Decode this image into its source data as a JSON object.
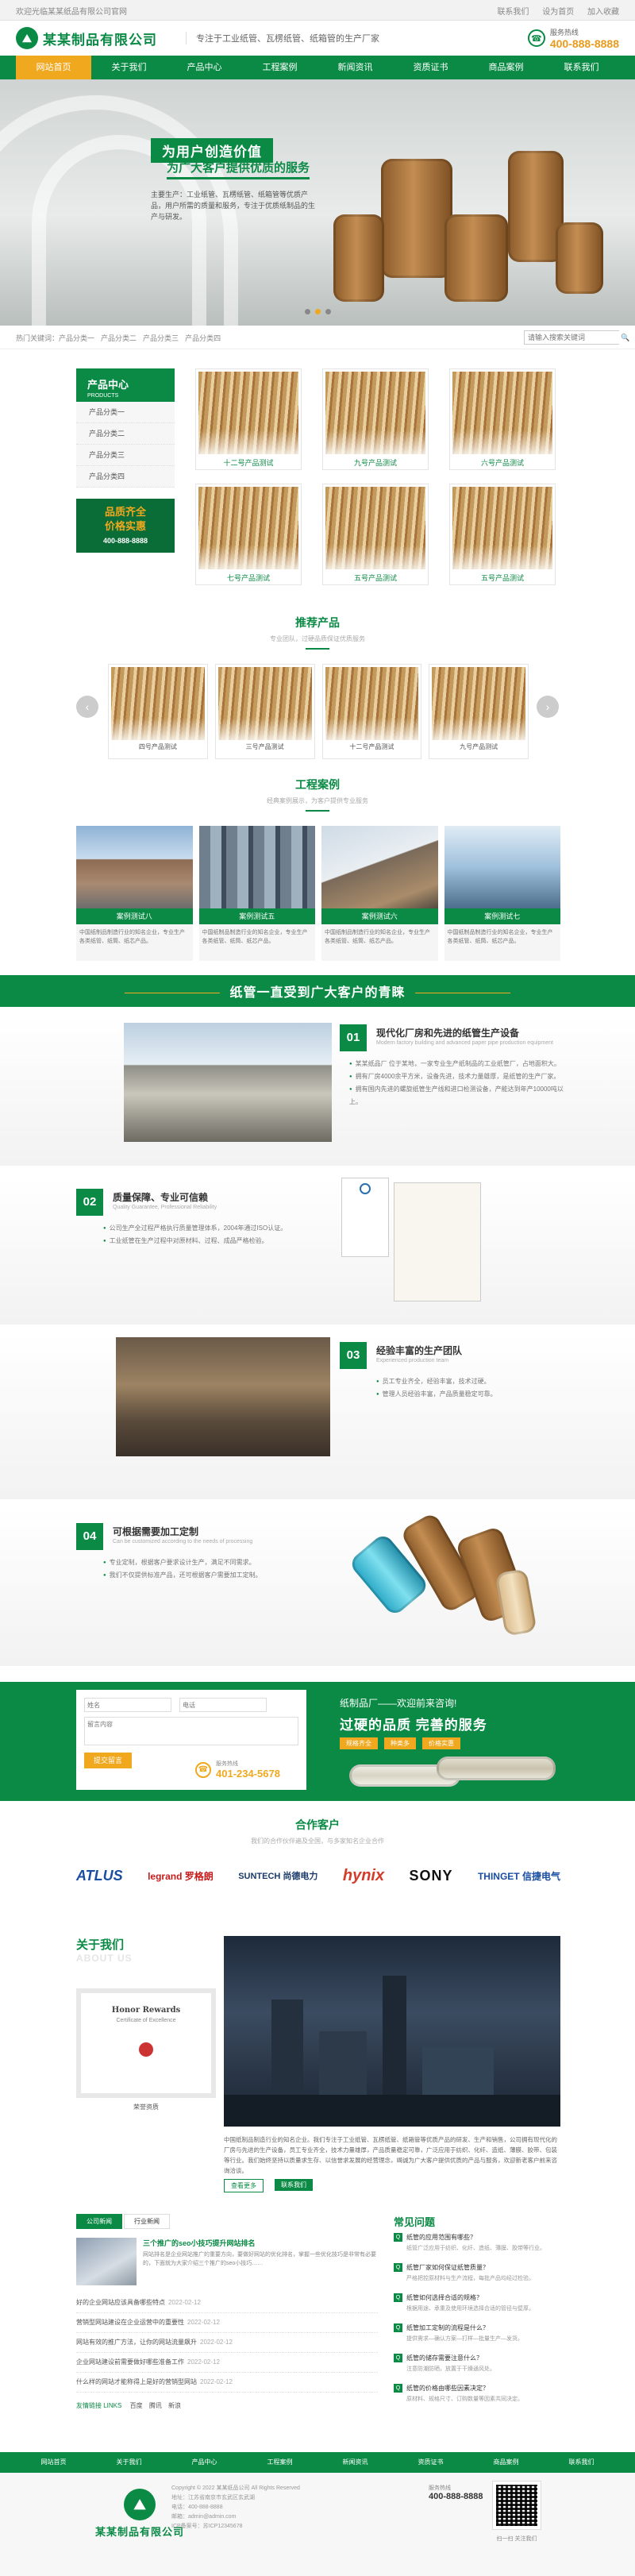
{
  "topbar": {
    "welcome": "欢迎光临某某纸品有限公司官网",
    "links": [
      "联系我们",
      "设为首页",
      "加入收藏"
    ]
  },
  "header": {
    "logo_text": "某某制品有限公司",
    "slogan": "专注于工业纸管、瓦楞纸管、纸箱管的生产厂家",
    "hotline_label": "服务热线",
    "hotline": "400-888-8888"
  },
  "nav": [
    "网站首页",
    "关于我们",
    "产品中心",
    "工程案例",
    "新闻资讯",
    "资质证书",
    "商品案例",
    "联系我们"
  ],
  "banner": {
    "title": "为用户创造价值",
    "subtitle": "为广大客户提供优质的服务",
    "text": "主要生产：工业纸管、瓦楞纸管、纸箱管等优质产品，用户所需的质量和服务，专注于优质纸制品的生产与研发。",
    "active_dot": 1
  },
  "crumb": {
    "hot_label": "热门关键词：",
    "keywords": [
      "产品分类一",
      "产品分类二",
      "产品分类三",
      "产品分类四"
    ],
    "search_placeholder": "请输入搜索关键词",
    "search_btn": "搜"
  },
  "prod_center": {
    "title": "产品中心",
    "en": "PRODUCTS",
    "cats": [
      "产品分类一",
      "产品分类二",
      "产品分类三",
      "产品分类四"
    ],
    "promo_line1": "品质齐全",
    "promo_line2": "价格实惠",
    "promo_phone": "400-888-8888",
    "items": [
      "十二号产品测试",
      "九号产品测试",
      "六号产品测试",
      "七号产品测试",
      "五号产品测试",
      "五号产品测试"
    ]
  },
  "recommend": {
    "title": "推荐产品",
    "sub": "专业团队，过硬品质保证优质服务",
    "items": [
      "四号产品测试",
      "三号产品测试",
      "十二号产品测试",
      "九号产品测试"
    ]
  },
  "cases": {
    "title": "工程案例",
    "sub": "经典案例展示，为客户提供专业服务",
    "items": [
      {
        "name": "案例测试八",
        "desc": "中国纸制品制造行业的知名企业，专业生产各类纸管、纸筒、纸芯产品。"
      },
      {
        "name": "案例测试五",
        "desc": "中国纸制品制造行业的知名企业，专业生产各类纸管、纸筒、纸芯产品。"
      },
      {
        "name": "案例测试六",
        "desc": "中国纸制品制造行业的知名企业，专业生产各类纸管、纸筒、纸芯产品。"
      },
      {
        "name": "案例测试七",
        "desc": "中国纸制品制造行业的知名企业，专业生产各类纸管、纸筒、纸芯产品。"
      }
    ]
  },
  "band_title": "纸管一直受到广大客户的青睐",
  "advantages": [
    {
      "num": "01",
      "title": "现代化厂房和先进的纸管生产设备",
      "sub": "Modern factory building and advanced paper pipe production equipment",
      "points": [
        "某某纸品厂 位于某地，一家专业生产纸制品的工业纸管厂，占地面积大。",
        "拥有厂房4000余平方米，设备先进，技术力量雄厚，是纸管的生产厂家。",
        "拥有国内先进的螺旋纸管生产线和进口检测设备，产能达到年产10000吨以上。"
      ]
    },
    {
      "num": "02",
      "title": "质量保障、专业可信赖",
      "sub": "Quality Guarantee, Professional Reliability",
      "points": [
        "公司生产全过程严格执行质量管理体系，2004年通过ISO认证。",
        "工业纸管在生产过程中对原材料、过程、成品严格检验。"
      ]
    },
    {
      "num": "03",
      "title": "经验丰富的生产团队",
      "sub": "Experienced production team",
      "points": [
        "员工专业齐全，经验丰富，技术过硬。",
        "管理人员经验丰富，产品质量稳定可靠。"
      ]
    },
    {
      "num": "04",
      "title": "可根据需要加工定制",
      "sub": "Can be customized according to the needs of processing",
      "points": [
        "专业定制，根据客户要求设计生产，满足不同需求。",
        "我们不仅提供标准产品，还可根据客户需要加工定制。"
      ]
    }
  ],
  "cta": {
    "name_ph": "姓名",
    "phone_ph": "电话",
    "msg_ph": "留言内容",
    "submit": "提交留言",
    "phone_label": "服务热线",
    "phone": "401-234-5678",
    "r1": "纸制品厂——欢迎前来咨询!",
    "r2": "过硬的品质 完善的服务",
    "tags": [
      "规格齐全",
      "种类多",
      "价格实惠"
    ]
  },
  "partners": {
    "title": "合作客户",
    "sub": "我们的合作伙伴遍及全国，与多家知名企业合作",
    "names": [
      "ATLUS",
      "legrand 罗格朗",
      "SUNTECH 尚德电力",
      "hynix",
      "SONY",
      "THINGET 信捷电气"
    ]
  },
  "about": {
    "title": "关于我们",
    "en": "ABOUT US",
    "cert_title": "Honor Rewards",
    "cert_sub": "Certificate of Excellence",
    "cert_caption": "荣誉资质",
    "text": "中国纸制品制造行业的知名企业。我们专注于工业纸管、瓦楞纸管、纸箱管等优质产品的研发、生产和销售，公司拥有现代化的厂房与先进的生产设备，员工专业齐全，技术力量雄厚，产品质量稳定可靠，广泛应用于纺织、化纤、造纸、薄膜、胶带、包装等行业。我们始终坚持以质量求生存、以信誉求发展的经营理念，竭诚为广大客户提供优质的产品与服务，欢迎新老客户前来咨询洽谈。",
    "more": "查看更多",
    "contact": "联系我们"
  },
  "news": {
    "tabs": [
      "公司新闻",
      "行业新闻"
    ],
    "feat_title": "三个推广的seo小技巧提升网站排名",
    "feat_text": "网站排名是企业网站推广的重要方向，要做好网站的优化排名，掌握一些优化技巧是非常有必要的，下面就为大家介绍三个推广的seo小技巧……",
    "items": [
      {
        "t": "好的企业网站应该具备哪些特点",
        "d": "2022-02-12"
      },
      {
        "t": "营销型网站建设在企业运营中的重要性",
        "d": "2022-02-12"
      },
      {
        "t": "网站有效的推广方法，让你的网站流量飙升",
        "d": "2022-02-12"
      },
      {
        "t": "企业网站建设前需要做好哪些准备工作",
        "d": "2022-02-12"
      },
      {
        "t": "什么样的网站才能称得上是好的营销型网站",
        "d": "2022-02-12"
      }
    ]
  },
  "faq": {
    "title": "常见问题",
    "items": [
      {
        "q": "纸管的应用范围有哪些？",
        "a": "纸管广泛应用于纺织、化纤、造纸、薄膜、胶带等行业。"
      },
      {
        "q": "纸管厂家如何保证纸管质量？",
        "a": "严格把控原材料与生产流程，每批产品均经过检验。"
      },
      {
        "q": "纸管如何选择合适的规格？",
        "a": "根据用途、承重及使用环境选择合适的管径与壁厚。"
      },
      {
        "q": "纸管加工定制的流程是什么？",
        "a": "提供需求—确认方案—打样—批量生产—发货。"
      },
      {
        "q": "纸管的储存需要注意什么？",
        "a": "注意防潮防晒，放置于干燥通风处。"
      },
      {
        "q": "纸管的价格由哪些因素决定？",
        "a": "原材料、规格尺寸、订购数量等因素共同决定。"
      }
    ]
  },
  "links": {
    "label": "友情链接 LINKS",
    "items": [
      "百度",
      "腾讯",
      "新浪"
    ]
  },
  "footer": {
    "nav": [
      "网站首页",
      "关于我们",
      "产品中心",
      "工程案例",
      "新闻资讯",
      "资质证书",
      "商品案例",
      "联系我们"
    ],
    "logo_text": "某某制品有限公司",
    "info": [
      "Copyright © 2022 某某纸品公司 All Rights Reserved",
      "地址：江苏省南京市玄武区玄武湖",
      "电话：400-888-8888",
      "邮箱：admin@admin.com",
      "ICP备案号：苏ICP12345678"
    ],
    "hot_label": "服务热线",
    "hot": "400-888-8888",
    "qr_caption": "扫一扫 关注我们"
  }
}
